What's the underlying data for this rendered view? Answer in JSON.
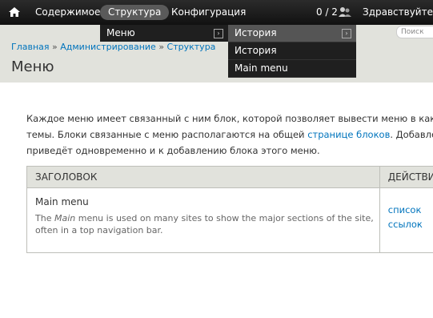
{
  "toolbar": {
    "home_icon": "home-icon",
    "items": [
      {
        "label": "Содержимое"
      },
      {
        "label": "Структура"
      },
      {
        "label": "Конфигурация"
      }
    ],
    "counter": "0 / 2",
    "users_icon": "users-icon",
    "greeting": "Здравствуйте, "
  },
  "dropdown_level1": {
    "item": "Меню"
  },
  "dropdown_level2": {
    "items": [
      {
        "label": "История"
      },
      {
        "label": "История"
      },
      {
        "label": "Main menu"
      }
    ]
  },
  "search": {
    "placeholder": "Поиск"
  },
  "breadcrumb": {
    "items": [
      "Главная",
      "Администрирование",
      "Структура"
    ],
    "separator": "»"
  },
  "page": {
    "title": "Меню"
  },
  "description": {
    "line1": "Каждое меню имеет связанный с ним блок, которой позволяет вывести меню в каком",
    "line2_before": "темы. Блоки связанные с меню располагаются на общей ",
    "line2_link": "странице блоков",
    "line2_after": ". Добавлен",
    "line3": "приведёт одновременно и к добавлению блока этого меню."
  },
  "table": {
    "headers": [
      "ЗАГОЛОВОК",
      "ДЕЙСТВИЯ"
    ],
    "rows": [
      {
        "name": "Main menu",
        "desc_before": "The ",
        "desc_em": "Main",
        "desc_after": " menu is used on many sites to show the major sections of the site, often in a top navigation bar.",
        "ops": [
          "список",
          "ссылок"
        ]
      }
    ]
  },
  "colors": {
    "toolbar_bg": "#1a1a1a",
    "header_bg": "#e1e2dc",
    "link": "#0074bd"
  }
}
